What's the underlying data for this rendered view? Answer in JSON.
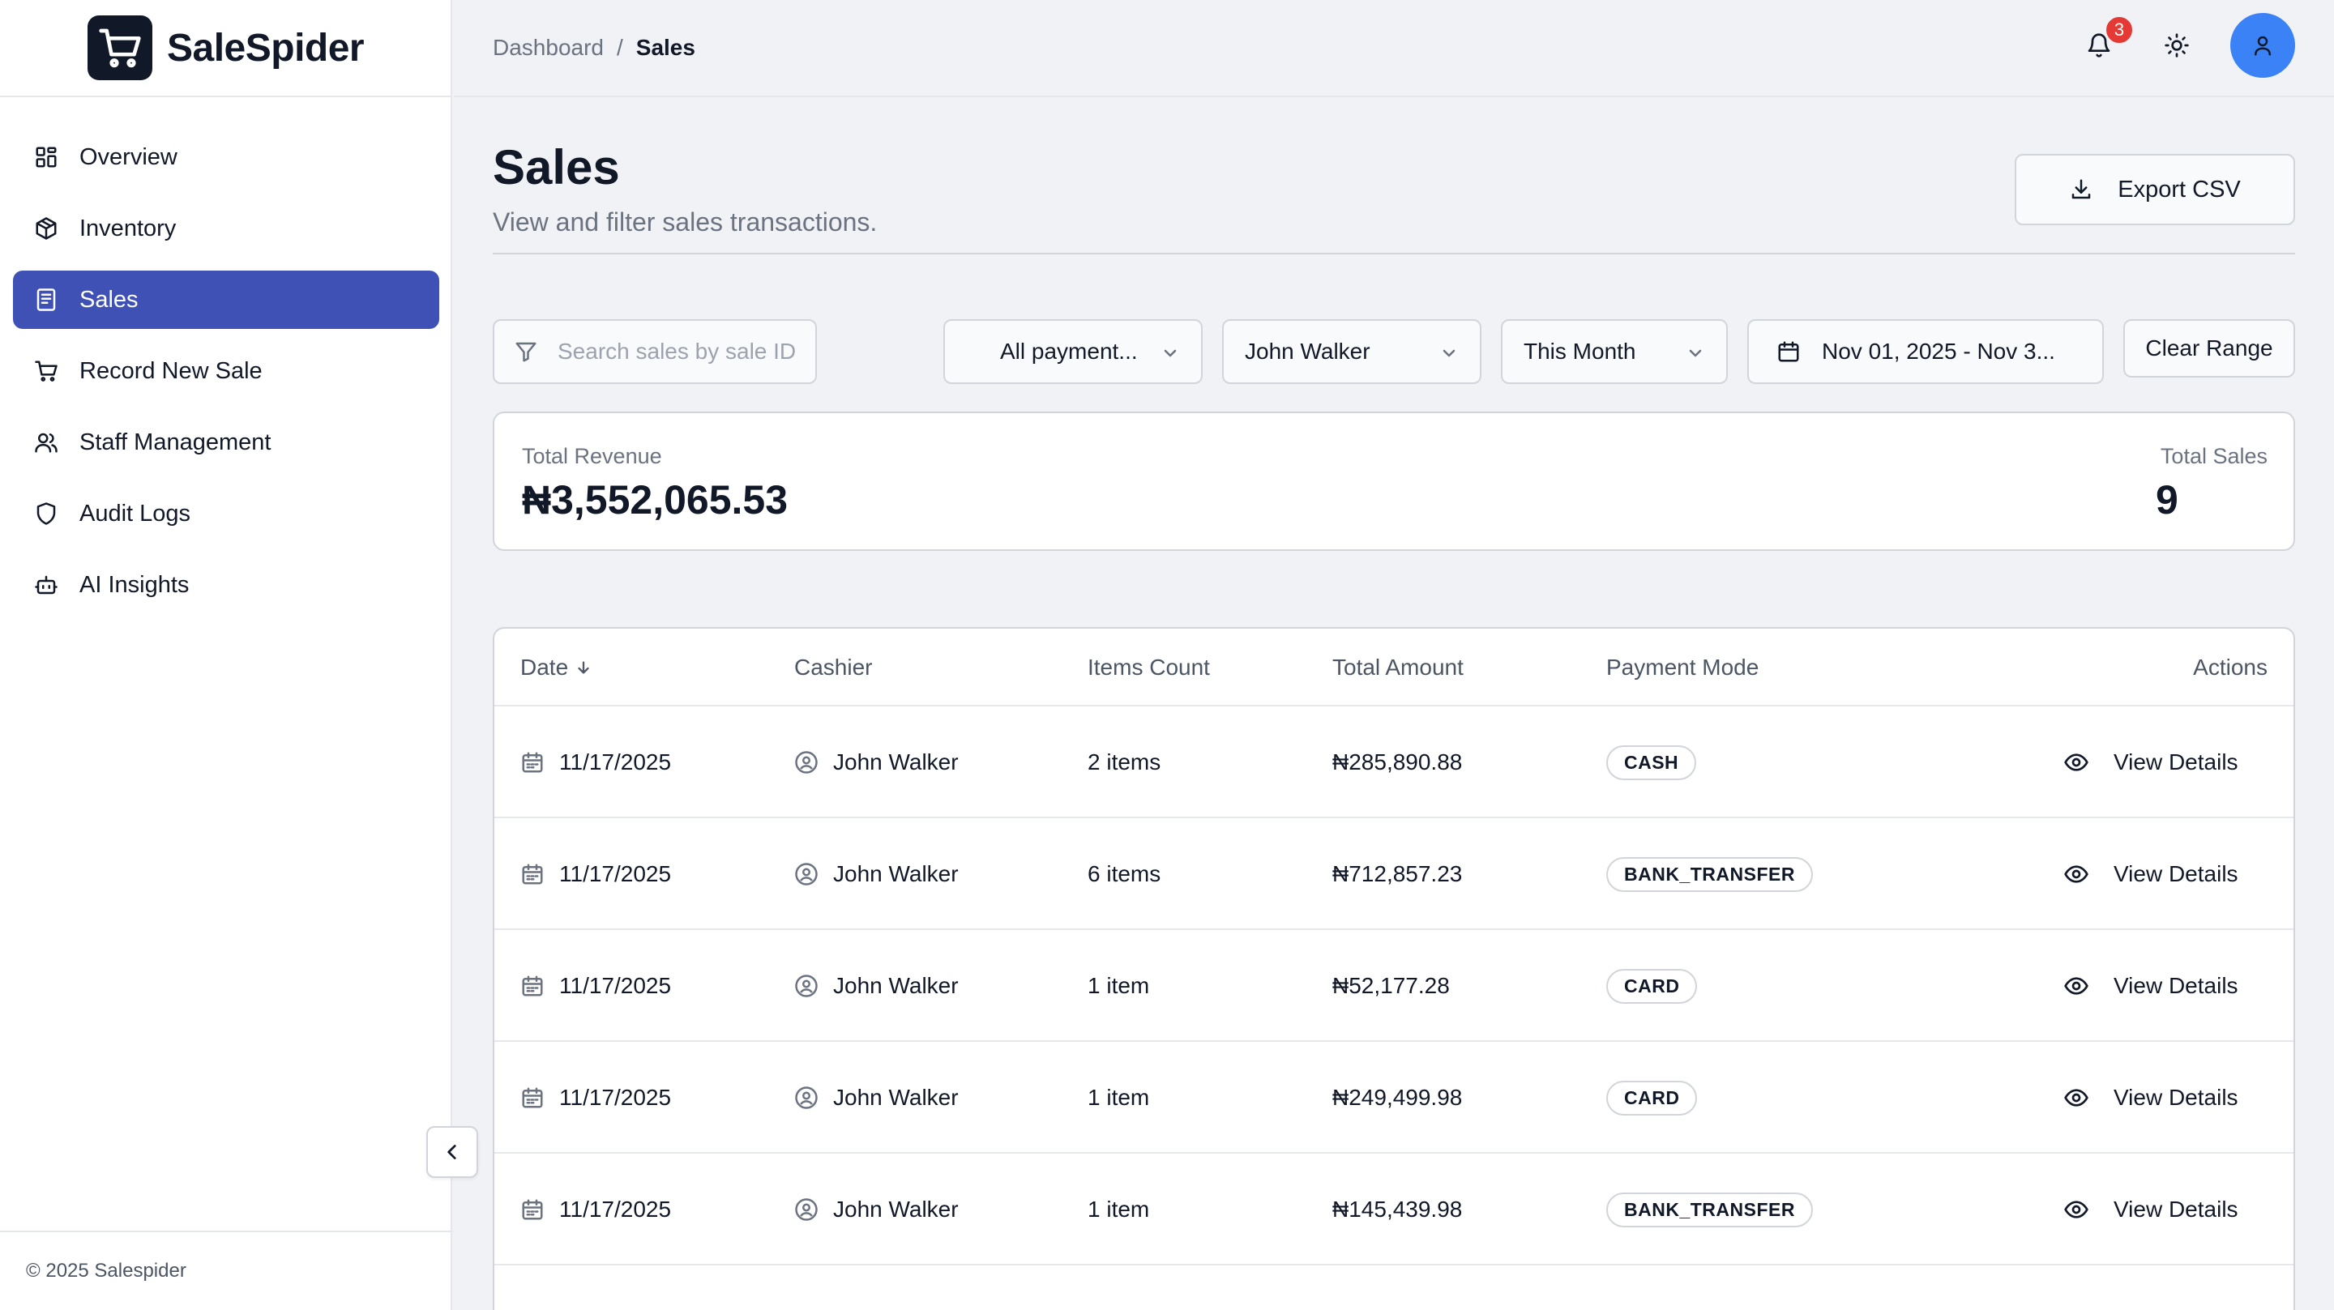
{
  "app": {
    "name": "SaleSpider",
    "footer": "© 2025 Salespider"
  },
  "sidebar": {
    "items": [
      {
        "label": "Overview",
        "icon": "grid-icon"
      },
      {
        "label": "Inventory",
        "icon": "package-icon"
      },
      {
        "label": "Sales",
        "icon": "receipt-icon",
        "active": true
      },
      {
        "label": "Record New Sale",
        "icon": "cart-icon"
      },
      {
        "label": "Staff Management",
        "icon": "users-icon"
      },
      {
        "label": "Audit Logs",
        "icon": "shield-icon"
      },
      {
        "label": "AI Insights",
        "icon": "bot-icon"
      }
    ]
  },
  "header": {
    "breadcrumb_root": "Dashboard",
    "breadcrumb_sep": "/",
    "breadcrumb_current": "Sales",
    "notification_count": "3"
  },
  "page": {
    "title": "Sales",
    "subtitle": "View and filter sales transactions.",
    "export_label": "Export CSV"
  },
  "filters": {
    "search_placeholder": "Search sales by sale ID",
    "payment": "All payment...",
    "cashier": "John Walker",
    "period": "This Month",
    "date_range": "Nov 01, 2025 - Nov 3...",
    "clear_label": "Clear Range"
  },
  "summary": {
    "revenue_label": "Total Revenue",
    "revenue_value": "₦3,552,065.53",
    "sales_label": "Total Sales",
    "sales_value": "9"
  },
  "table": {
    "columns": [
      "Date",
      "Cashier",
      "Items Count",
      "Total Amount",
      "Payment Mode",
      "Actions"
    ],
    "action_label": "View Details",
    "rows": [
      {
        "date": "11/17/2025",
        "cashier": "John Walker",
        "items": "2 items",
        "amount": "₦285,890.88",
        "payment": "CASH"
      },
      {
        "date": "11/17/2025",
        "cashier": "John Walker",
        "items": "6 items",
        "amount": "₦712,857.23",
        "payment": "BANK_TRANSFER"
      },
      {
        "date": "11/17/2025",
        "cashier": "John Walker",
        "items": "1 item",
        "amount": "₦52,177.28",
        "payment": "CARD"
      },
      {
        "date": "11/17/2025",
        "cashier": "John Walker",
        "items": "1 item",
        "amount": "₦249,499.98",
        "payment": "CARD"
      },
      {
        "date": "11/17/2025",
        "cashier": "John Walker",
        "items": "1 item",
        "amount": "₦145,439.98",
        "payment": "BANK_TRANSFER"
      }
    ]
  },
  "colors": {
    "accent": "#3f51b5",
    "avatar": "#3b82f6",
    "badge": "#e53935"
  }
}
